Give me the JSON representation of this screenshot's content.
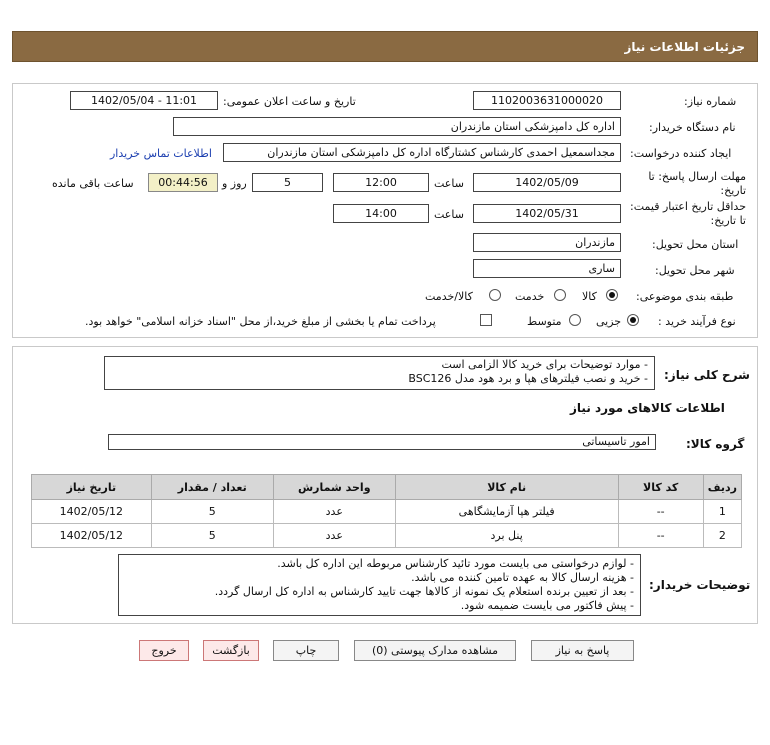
{
  "header": {
    "title": "جزئیات اطلاعات نیاز"
  },
  "fields": {
    "need_number_label": "شماره نیاز:",
    "need_number": "1102003631000020",
    "announce_label": "تاریخ و ساعت اعلان عمومی:",
    "announce_value": "1402/05/04 - 11:01",
    "buyer_org_label": "نام دستگاه خریدار:",
    "buyer_org": "اداره کل دامپزشکی استان مازندران",
    "creator_label": "ایجاد کننده درخواست:",
    "creator": "مجداسمعیل احمدی کارشناس کشتارگاه اداره کل دامپزشکی استان مازندران",
    "contact_link": "اطلاعات تماس خریدار",
    "reply_deadline_label": "مهلت ارسال پاسخ: تا تاریخ:",
    "reply_date": "1402/05/09",
    "time_label": "ساعت",
    "reply_time": "12:00",
    "days_value": "5",
    "days_label": "روز و",
    "remaining_time": "00:44:56",
    "remaining_label": "ساعت باقی مانده",
    "validity_label": "حداقل تاریخ اعتبار قیمت: تا تاریخ:",
    "validity_date": "1402/05/31",
    "validity_time_label": "ساعت",
    "validity_time": "14:00",
    "province_label": "استان محل تحویل:",
    "province": "مازندران",
    "city_label": "شهر محل تحویل:",
    "city": "ساری",
    "category_label": "طبقه بندی موضوعی:",
    "category_options": [
      "کالا",
      "خدمت",
      "کالا/خدمت"
    ],
    "process_label": "نوع فرآیند خرید :",
    "process_options": [
      "جزیی",
      "متوسط"
    ],
    "payment_note": "پرداخت تمام یا بخشی از مبلغ خرید،از محل \"اسناد خزانه اسلامی\" خواهد بود."
  },
  "summary": {
    "label": "شرح کلی نیاز:",
    "lines": [
      "- موارد توضیحات برای خرید کالا الزامی است",
      "- خرید و نصب فیلترهای هپا و برد هود مدل BSC126"
    ]
  },
  "goods": {
    "section_title": "اطلاعات کالاهای مورد نیاز",
    "group_label": "گروه کالا:",
    "group_value": "امور تاسیساتی",
    "columns": [
      "ردیف",
      "کد کالا",
      "نام کالا",
      "واحد شمارش",
      "تعداد / مقدار",
      "تاریخ نیاز"
    ],
    "rows": [
      [
        "1",
        "--",
        "فیلتر هپا آزمایشگاهی",
        "عدد",
        "5",
        "1402/05/12"
      ],
      [
        "2",
        "--",
        "پنل برد",
        "عدد",
        "5",
        "1402/05/12"
      ]
    ]
  },
  "buyer_notes": {
    "label": "توضیحات خریدار:",
    "lines": [
      "- لوازم درخواستی می بایست مورد تائید کارشناس مربوطه این اداره کل باشد.",
      "- هزینه ارسال کالا به عهده تامین کننده می باشد.",
      "- بعد از تعیین برنده استعلام یک نمونه از کالاها جهت تایید کارشناس به اداره کل ارسال گردد.",
      "- پیش فاکتور می بایست ضمیمه شود."
    ]
  },
  "buttons": {
    "reply": "پاسخ به نیاز",
    "attachments": "مشاهده مدارک پیوستی (0)",
    "print": "چاپ",
    "back": "بازگشت",
    "exit": "خروج"
  }
}
